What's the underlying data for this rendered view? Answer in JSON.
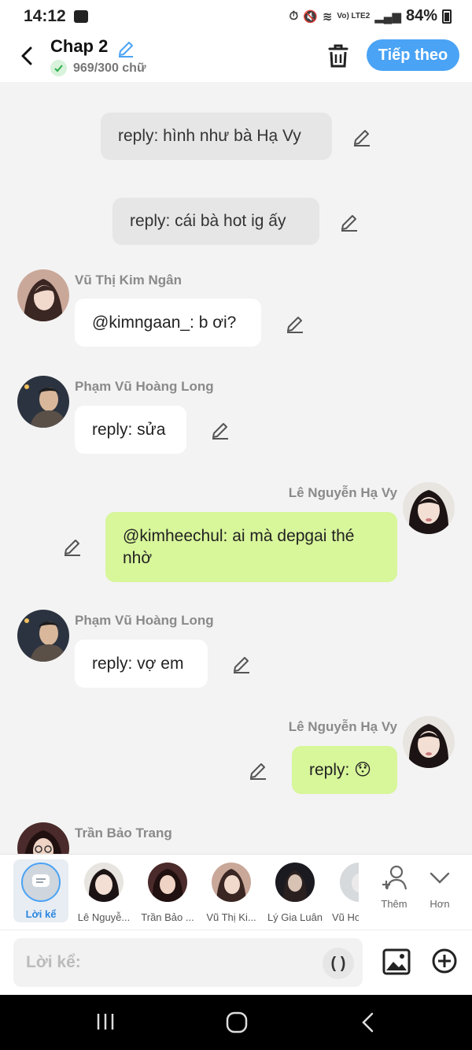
{
  "status_bar": {
    "time": "14:12",
    "network": "Vo) LTE2",
    "battery": "84%"
  },
  "header": {
    "title": "Chap 2",
    "word_count": "969/300 chữ",
    "next_label": "Tiếp theo"
  },
  "messages": [
    {
      "type": "narration",
      "text": "reply: hình như bà Hạ Vy"
    },
    {
      "type": "narration",
      "text": "reply: cái bà hot ig ấy"
    },
    {
      "type": "left",
      "sender": "Vũ Thị Kim Ngân",
      "text": "@kimngaan_: b ơi?"
    },
    {
      "type": "left",
      "sender": "Phạm Vũ Hoàng Long",
      "text": "reply: sửa"
    },
    {
      "type": "right",
      "sender": "Lê Nguyễn Hạ Vy",
      "text": "@kimheechul: ai mà depgai thé nhờ"
    },
    {
      "type": "left",
      "sender": "Phạm Vũ Hoàng Long",
      "text": "reply: vợ em"
    },
    {
      "type": "right",
      "sender": "Lê Nguyễn Hạ Vy",
      "text": "reply: 😯"
    },
    {
      "type": "left",
      "sender": "Trần Bảo Trang",
      "text": ""
    }
  ],
  "character_bar": {
    "narrator_label": "Lời kể",
    "characters": [
      "Lê Nguyễ...",
      "Trần Bảo ...",
      "Vũ Thị Ki...",
      "Lý Gia Luân",
      "Vũ Hơ"
    ],
    "add_label": "Thêm",
    "more_label": "Hơn"
  },
  "input": {
    "placeholder": "Lời kể:",
    "paren_label": "( )"
  },
  "colors": {
    "accent": "#4aa3f5",
    "own_bubble": "#d8f69a",
    "other_bubble": "#ffffff",
    "narration_bubble": "#e6e6e6"
  }
}
